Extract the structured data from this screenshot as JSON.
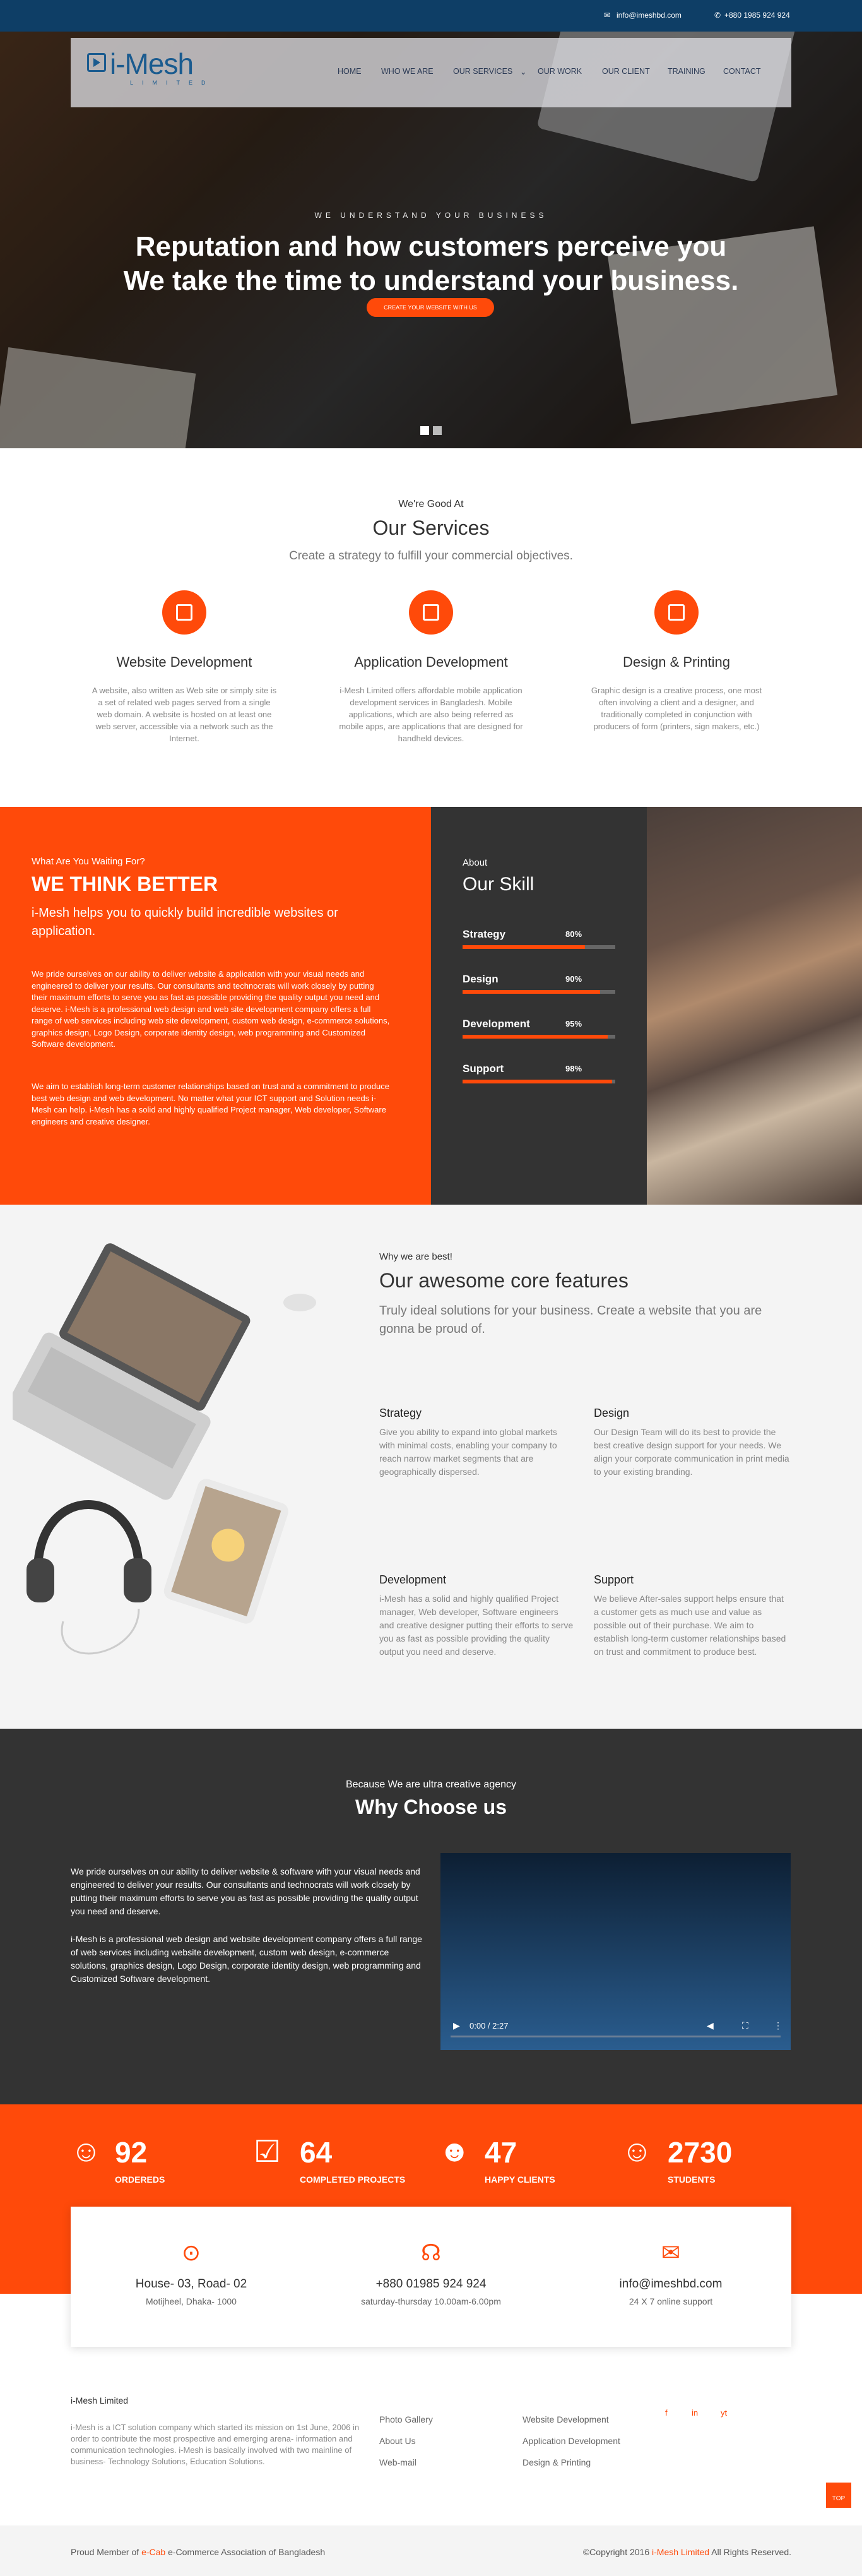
{
  "topbar": {
    "email": "info@imeshbd.com",
    "phone": "+880 1985 924 924"
  },
  "logo": {
    "name": "i-Mesh",
    "sub": "LIMITED"
  },
  "nav": [
    {
      "label": "HOME"
    },
    {
      "label": "WHO WE ARE"
    },
    {
      "label": "OUR SERVICES"
    },
    {
      "label": "OUR WORK"
    },
    {
      "label": "OUR CLIENT"
    },
    {
      "label": "TRAINING"
    },
    {
      "label": "CONTACT"
    }
  ],
  "hero": {
    "kicker": "WE UNDERSTAND YOUR BUSINESS",
    "title1": "Reputation and how customers perceive you",
    "title2": "We take the time to understand your business.",
    "button": "CREATE YOUR WEBSITE WITH US"
  },
  "services": {
    "kicker": "We're Good At",
    "title": "Our Services",
    "subtitle": "Create a strategy to fulfill your commercial objectives.",
    "items": [
      {
        "title": "Website Development",
        "text": "A website, also written as Web site or simply site is a set of related web pages served from a single web domain. A website is hosted on at least one web server, accessible via a network such as the Internet."
      },
      {
        "title": "Application Development",
        "text": "i-Mesh Limited offers affordable mobile application development services in Bangladesh. Mobile applications, which are also being referred as mobile apps, are applications that are designed for handheld devices."
      },
      {
        "title": "Design & Printing",
        "text": "Graphic design is a creative process, one most often involving a client and a designer, and traditionally completed in conjunction with producers of form (printers, sign makers, etc.)"
      }
    ]
  },
  "think": {
    "kicker": "What Are You Waiting For?",
    "title": "WE THINK BETTER",
    "lead": "i-Mesh helps you to quickly build incredible websites or application.",
    "p1": "We pride ourselves on our ability to deliver website & application with your visual needs and engineered to deliver your results. Our consultants and technocrats will work closely by putting their maximum efforts to serve you as fast as possible providing the quality output you need and deserve. i-Mesh is a professional web design and web site development company offers a full range of web services including web site development, custom web design, e-commerce solutions, graphics design, Logo Design, corporate identity design, web programming and Customized Software development.",
    "p2": "We aim to establish long-term customer relationships based on trust and a commitment to produce best web design and web development. No matter what your ICT support and Solution needs i-Mesh can help. i-Mesh has a solid and highly qualified Project manager, Web developer, Software engineers and creative designer."
  },
  "skills": {
    "kicker": "About",
    "title": "Our Skill",
    "items": [
      {
        "name": "Strategy",
        "value": "80%",
        "pct": 80
      },
      {
        "name": "Design",
        "value": "90%",
        "pct": 90
      },
      {
        "name": "Development",
        "value": "95%",
        "pct": 95
      },
      {
        "name": "Support",
        "value": "98%",
        "pct": 98
      }
    ]
  },
  "features": {
    "kicker": "Why we are best!",
    "title": "Our awesome core features",
    "subtitle": "Truly ideal solutions for your business. Create a website that you are gonna be proud of.",
    "items": [
      {
        "title": "Strategy",
        "text": "Give you ability to expand into global markets with minimal costs, enabling your company to reach narrow market segments that are geographically dispersed."
      },
      {
        "title": "Design",
        "text": "Our Design Team will do its best to provide the best creative design support for your needs. We align your corporate communication in print media to your existing branding."
      },
      {
        "title": "Development",
        "text": "i-Mesh has a solid and highly qualified Project manager, Web developer, Software engineers and creative designer putting their efforts to serve you as fast as possible providing the quality output you need and deserve."
      },
      {
        "title": "Support",
        "text": "We believe After-sales support helps ensure that a customer gets as much use and value as possible out of their purchase. We aim to establish long-term customer relationships based on trust and commitment to produce best."
      }
    ]
  },
  "why": {
    "kicker": "Because We are ultra creative agency",
    "title": "Why Choose us",
    "p1": "We pride ourselves on our ability to deliver website & software with your visual needs and engineered to deliver your results. Our consultants and technocrats will work closely by putting their maximum efforts to serve you as fast as possible providing the quality output you need and deserve.",
    "p2": "i-Mesh is a professional web design and website development company offers a full range of web services including website development, custom web design, e-commerce solutions, graphics design, Logo Design, corporate identity design, web programming and Customized Software development.",
    "video_time": "0:00 / 2:27"
  },
  "stats": [
    {
      "num": "92",
      "label": "ORDEREDS",
      "icon": "user-icon"
    },
    {
      "num": "64",
      "label": "COMPLETED PROJECTS",
      "icon": "check-icon"
    },
    {
      "num": "47",
      "label": "HAPPY CLIENTS",
      "icon": "smile-icon"
    },
    {
      "num": "2730",
      "label": "STUDENTS",
      "icon": "user-icon"
    }
  ],
  "contact": [
    {
      "main": "House- 03, Road- 02",
      "sub": "Motijheel, Dhaka- 1000",
      "icon": "location-icon"
    },
    {
      "main": "+880 01985 924 924",
      "sub": "saturday-thursday 10.00am-6.00pm",
      "icon": "headset-icon"
    },
    {
      "main": "info@imeshbd.com",
      "sub": "24 X 7 online support",
      "icon": "mail-icon"
    }
  ],
  "footer": {
    "company": "i-Mesh Limited",
    "about": "i-Mesh is a ICT solution company which started its mission on 1st June, 2006 in order to contribute the most prospective and emerging arena- information and communication technologies. i-Mesh is basically involved with two mainline of business- Technology Solutions, Education Solutions.",
    "links1": [
      "Photo Gallery",
      "About Us",
      "Web-mail"
    ],
    "links2": [
      "Website Development",
      "Application Development",
      "Design & Printing"
    ],
    "social": [
      "f",
      "in",
      "yt"
    ],
    "member_pre": "Proud Member of ",
    "member_link": "e-Cab",
    "member_post": " e-Commerce Association of Bangladesh",
    "copy_pre": "©Copyright 2016 ",
    "copy_link": "i-Mesh Limited",
    "copy_post": " All Rights Reserved.",
    "top": "TOP"
  },
  "colors": {
    "accent": "#ff4a0a",
    "dark": "#333333",
    "navy": "#0e3e66"
  }
}
